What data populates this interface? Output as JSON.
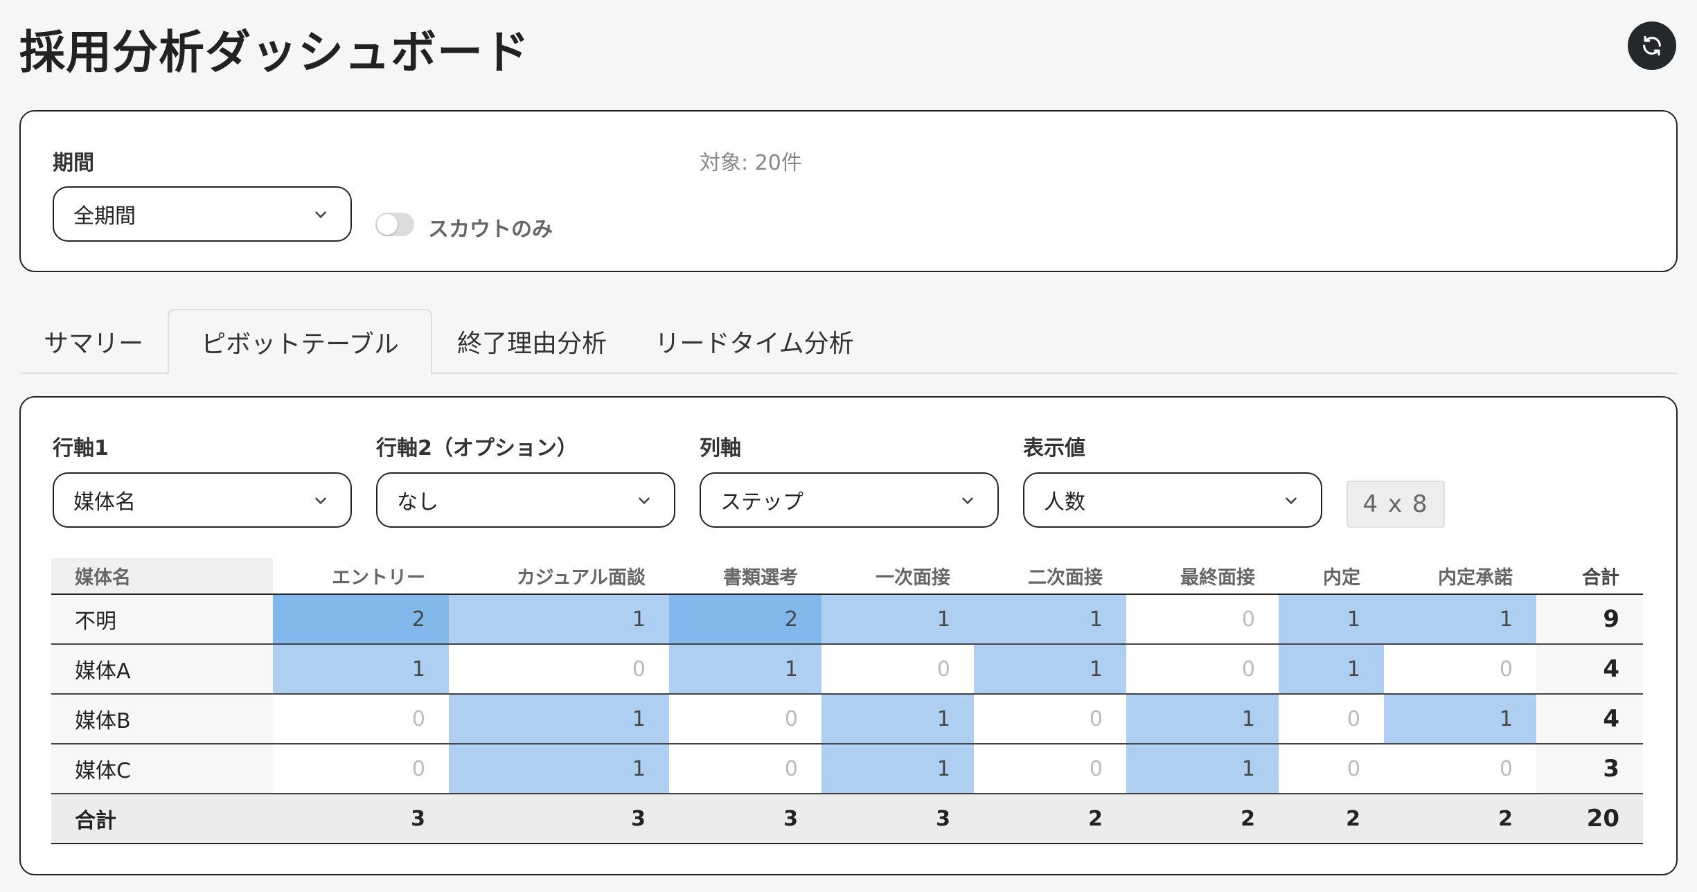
{
  "header": {
    "title": "採用分析ダッシュボード",
    "refresh_icon": "refresh-icon"
  },
  "filters": {
    "period_label": "期間",
    "period_value": "全期間",
    "count_text": "対象: 20件",
    "scout_toggle_label": "スカウトのみ",
    "scout_toggle_on": false
  },
  "tabs": [
    {
      "label": "サマリー",
      "active": false
    },
    {
      "label": "ピボットテーブル",
      "active": true
    },
    {
      "label": "終了理由分析",
      "active": false
    },
    {
      "label": "リードタイム分析",
      "active": false
    }
  ],
  "pivot_controls": {
    "row_axis1_label": "行軸1",
    "row_axis1_value": "媒体名",
    "row_axis2_label": "行軸2（オプション）",
    "row_axis2_value": "なし",
    "col_axis_label": "列軸",
    "col_axis_value": "ステップ",
    "display_label": "表示値",
    "display_value": "人数",
    "dimension_badge": "4 x 8"
  },
  "colors": {
    "cell_light": "#aecff2",
    "cell_strong": "#82b8eb",
    "zero_text": "#bbbbbb"
  },
  "table": {
    "row_header": "媒体名",
    "columns": [
      "エントリー",
      "カジュアル面談",
      "書類選考",
      "一次面接",
      "二次面接",
      "最終面接",
      "内定",
      "内定承諾"
    ],
    "total_header": "合計",
    "rows": [
      {
        "label": "不明",
        "values": [
          "2",
          "1",
          "2",
          "1",
          "1",
          "0",
          "1",
          "1"
        ],
        "total": "9"
      },
      {
        "label": "媒体A",
        "values": [
          "1",
          "0",
          "1",
          "0",
          "1",
          "0",
          "1",
          "0"
        ],
        "total": "4"
      },
      {
        "label": "媒体B",
        "values": [
          "0",
          "1",
          "0",
          "1",
          "0",
          "1",
          "0",
          "1"
        ],
        "total": "4"
      },
      {
        "label": "媒体C",
        "values": [
          "0",
          "1",
          "0",
          "1",
          "0",
          "1",
          "0",
          "0"
        ],
        "total": "3"
      }
    ],
    "footer": {
      "label": "合計",
      "values": [
        "3",
        "3",
        "3",
        "3",
        "2",
        "2",
        "2",
        "2"
      ],
      "total": "20"
    }
  }
}
